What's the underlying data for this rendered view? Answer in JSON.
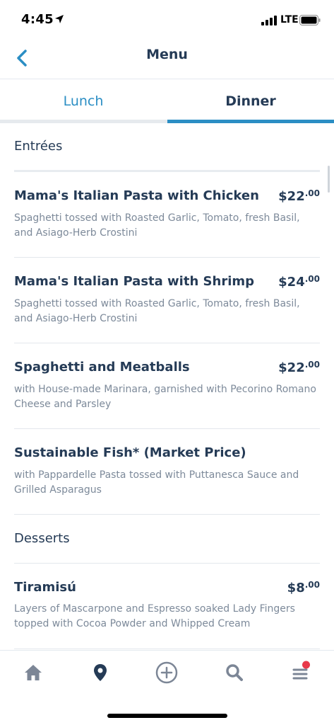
{
  "status_bar": {
    "time": "4:45",
    "network": "LTE"
  },
  "header": {
    "title": "Menu"
  },
  "tabs": [
    {
      "label": "Lunch",
      "selected": false
    },
    {
      "label": "Dinner",
      "selected": true
    }
  ],
  "sections": [
    {
      "title": "Entrées",
      "items": [
        {
          "name": "Mama's Italian Pasta with Chicken",
          "price_dollars": "$22",
          "price_cents": ".00",
          "desc": "Spaghetti tossed with Roasted Garlic, Tomato, fresh Basil, and Asiago-Herb Crostini"
        },
        {
          "name": "Mama's Italian Pasta with Shrimp",
          "price_dollars": "$24",
          "price_cents": ".00",
          "desc": "Spaghetti tossed with Roasted Garlic, Tomato, fresh Basil, and Asiago-Herb Crostini"
        },
        {
          "name": "Spaghetti and Meatballs",
          "price_dollars": "$22",
          "price_cents": ".00",
          "desc": "with House-made Marinara, garnished with Pecorino Romano Cheese and Parsley"
        },
        {
          "name": "Sustainable Fish* (Market Price)",
          "desc": "with Pappardelle Pasta tossed with Puttanesca Sauce and Grilled Asparagus"
        }
      ]
    },
    {
      "title": "Desserts",
      "items": [
        {
          "name": "Tiramisú",
          "price_dollars": "$8",
          "price_cents": ".00",
          "desc": "Layers of Mascarpone and Espresso soaked Lady Fingers topped with Cocoa Powder and Whipped Cream"
        }
      ]
    }
  ],
  "tab_bar": {
    "icons": [
      "home-icon",
      "location-pin-icon",
      "add-circle-icon",
      "search-icon",
      "menu-icon"
    ]
  },
  "colors": {
    "accent": "#2b8ec4",
    "text_dark": "#253b56",
    "text_muted": "#7d8a9a",
    "notification": "#e8394a"
  }
}
